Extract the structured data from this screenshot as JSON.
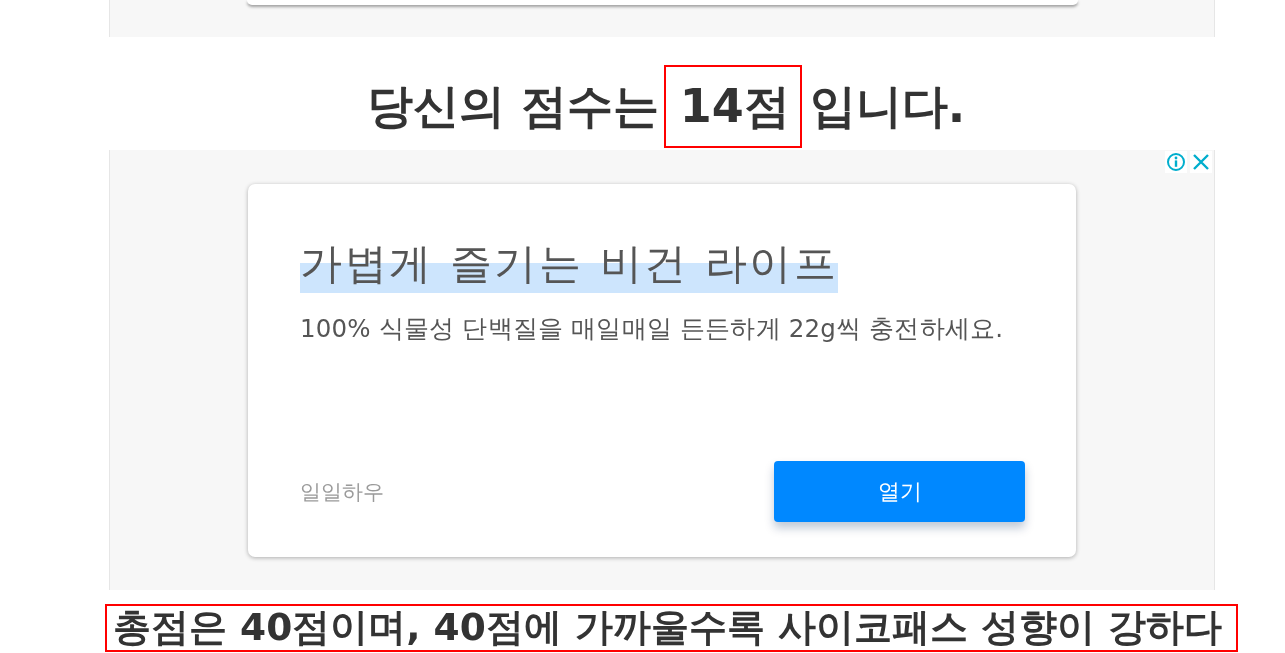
{
  "score_heading": {
    "prefix": "당신의 점수는",
    "score": "14점",
    "suffix": "입니다."
  },
  "ad": {
    "title": "가볍게 즐기는 비건 라이프",
    "description": "100% 식물성 단백질을 매일매일 든든하게 22g씩 충전하세요.",
    "advertiser": "일일하우",
    "button": "열기"
  },
  "total_note": "총점은 40점이며, 40점에 가까울수록 사이코패스 성향이 강하다"
}
